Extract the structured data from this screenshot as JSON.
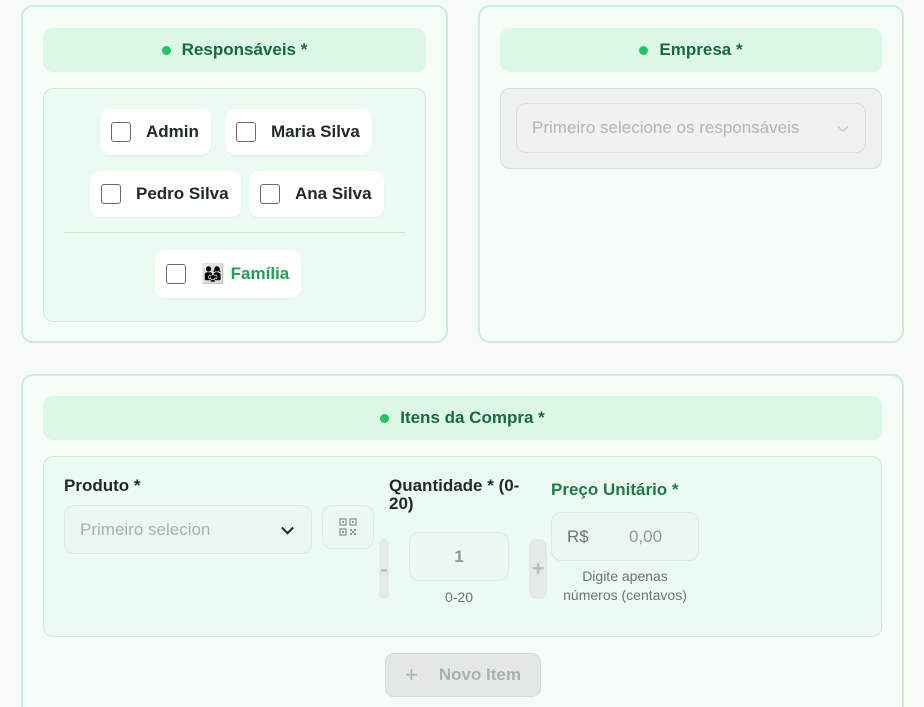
{
  "responsaveis": {
    "title": "Responsáveis *",
    "options": [
      "Admin",
      "Maria Silva",
      "Pedro Silva",
      "Ana Silva"
    ],
    "family_label": "Família",
    "family_emoji": "👨‍👩‍👧"
  },
  "empresa": {
    "title": "Empresa *",
    "placeholder": "Primeiro selecione os responsáveis"
  },
  "itens": {
    "title": "Itens da Compra *",
    "produto_label": "Produto *",
    "produto_placeholder": "Primeiro selecion",
    "quantidade_label_line1": "Quantidade * (0-",
    "quantidade_label_line2": "20)",
    "quantidade_value": "1",
    "quantidade_range": "0-20",
    "minus": "-",
    "plus": "+",
    "preco_label": "Preço Unitário *",
    "currency": "R$",
    "preco_value": "0,00",
    "preco_hint_line1": "Digite apenas",
    "preco_hint_line2": "números (centavos)",
    "new_item_icon": "+",
    "new_item_label": "Novo Item"
  },
  "colors": {
    "accent": "#22c55e",
    "header_bg": "#ddf8e7",
    "header_text": "#176b3b"
  }
}
